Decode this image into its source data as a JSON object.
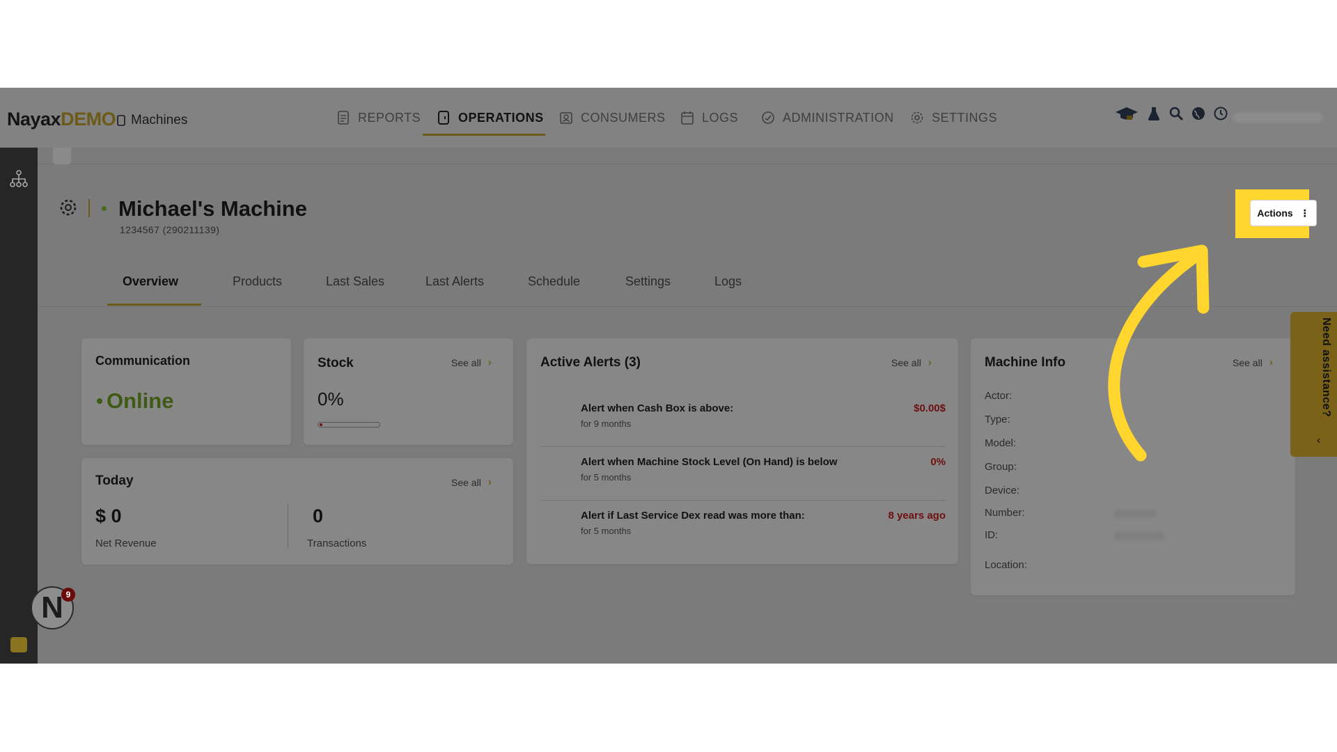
{
  "header": {
    "logo_main": "Nayax",
    "logo_demo": "DEMO",
    "breadcrumb": "Machines",
    "nav": [
      {
        "label": "REPORTS",
        "icon": "report-icon"
      },
      {
        "label": "OPERATIONS",
        "icon": "device-icon",
        "active": true
      },
      {
        "label": "CONSUMERS",
        "icon": "consumer-icon"
      },
      {
        "label": "LOGS",
        "icon": "calendar-icon"
      },
      {
        "label": "ADMINISTRATION",
        "icon": "admin-icon"
      },
      {
        "label": "SETTINGS",
        "icon": "gear-icon"
      }
    ],
    "right_icons": [
      "graduation-cap-icon",
      "flask-icon",
      "search-icon",
      "globe-icon",
      "clock-icon"
    ]
  },
  "machine": {
    "name": "Michael's Machine",
    "id_line": "1234567 (290211139)",
    "actions_label": "Actions"
  },
  "tabs": [
    "Overview",
    "Products",
    "Last Sales",
    "Last Alerts",
    "Schedule",
    "Settings",
    "Logs"
  ],
  "communication": {
    "title": "Communication",
    "status": "Online"
  },
  "stock": {
    "title": "Stock",
    "see_all": "See all",
    "percent_text": "0%",
    "fill_fraction": 0.0
  },
  "today": {
    "title": "Today",
    "see_all": "See all",
    "revenue_value": "$ 0",
    "revenue_label": "Net Revenue",
    "transactions_value": "0",
    "transactions_label": "Transactions"
  },
  "alerts": {
    "title": "Active Alerts (3)",
    "see_all": "See all",
    "items": [
      {
        "name": "Alert when Cash Box is above:",
        "when": "for 9 months",
        "value": "$0.00$"
      },
      {
        "name": "Alert when Machine Stock Level (On Hand) is below",
        "when": "for 5 months",
        "value": "0%"
      },
      {
        "name": "Alert if Last Service Dex read was more than:",
        "when": "for 5 months",
        "value": "8 years ago"
      }
    ]
  },
  "machine_info": {
    "title": "Machine Info",
    "see_all": "See all",
    "rows": [
      "Actor:",
      "Type:",
      "Model:",
      "Group:",
      "Device:",
      "Number:",
      "ID:",
      "Location:"
    ]
  },
  "assistance": {
    "label": "Need assistance?"
  },
  "notifications": {
    "count": "9",
    "avatar_letter": "N"
  },
  "colors": {
    "accent": "#ffd52e",
    "online": "#3e5a14",
    "alert_value": "#6d1010"
  }
}
